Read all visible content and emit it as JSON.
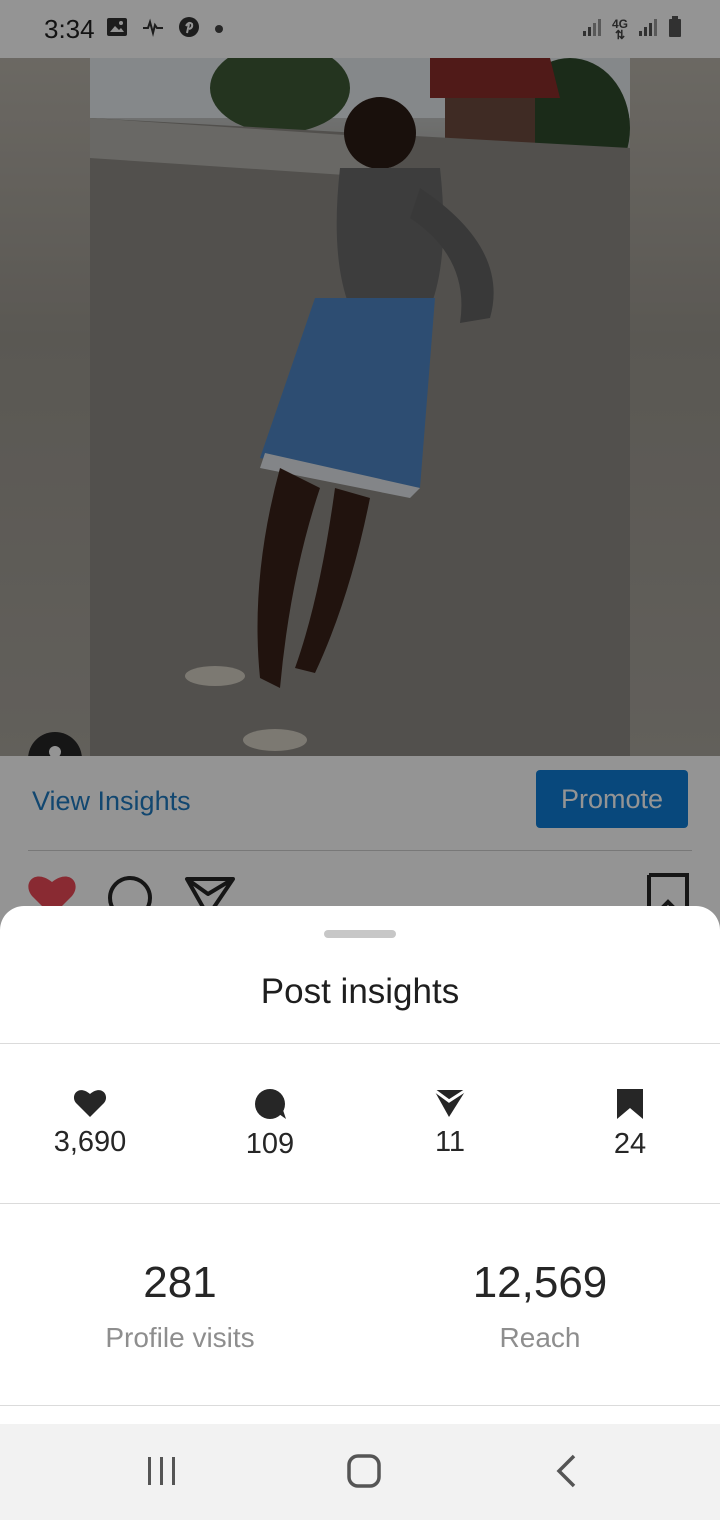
{
  "status_bar": {
    "time": "3:34",
    "left_icons": [
      "image-icon",
      "audio-wave-icon",
      "pinterest-icon",
      "dot-icon"
    ],
    "right_icons": [
      "signal-icon",
      "4g-icon",
      "signal-icon",
      "battery-icon"
    ],
    "network_label": "4G"
  },
  "post": {
    "view_insights_label": "View Insights",
    "promote_label": "Promote",
    "actions": [
      "like-icon",
      "comment-icon",
      "share-icon",
      "save-icon"
    ],
    "liked_color": "#ed4956"
  },
  "sheet": {
    "title": "Post insights",
    "stats": [
      {
        "icon": "heart-icon",
        "value": "3,690"
      },
      {
        "icon": "comment-icon",
        "value": "109"
      },
      {
        "icon": "send-icon",
        "value": "11"
      },
      {
        "icon": "bookmark-icon",
        "value": "24"
      }
    ],
    "summary": [
      {
        "value": "281",
        "label": "Profile visits"
      },
      {
        "value": "12,569",
        "label": "Reach"
      }
    ]
  },
  "nav": {
    "buttons": [
      "recent-apps-icon",
      "home-icon",
      "back-icon"
    ]
  },
  "colors": {
    "accent": "#0e7dd6",
    "link": "#1f7bc1"
  }
}
